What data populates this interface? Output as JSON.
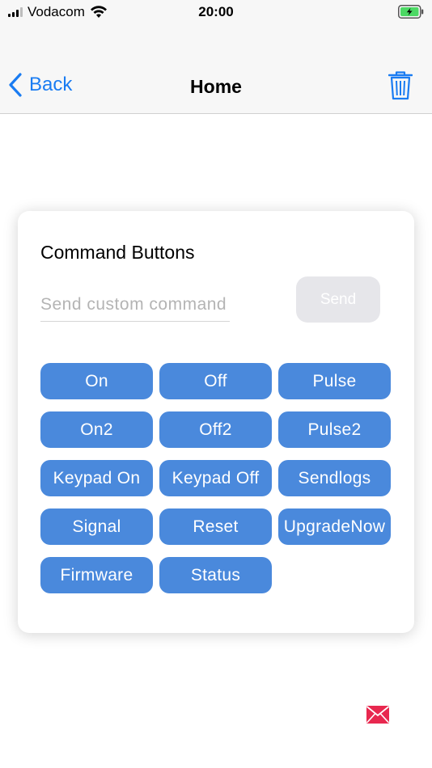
{
  "status_bar": {
    "carrier": "Vodacom",
    "time": "20:00",
    "icons": [
      "signal-icon",
      "wifi-icon",
      "battery-charging-icon"
    ],
    "battery_color": "#4cd964"
  },
  "nav_bar": {
    "back_label": "Back",
    "title": "Home",
    "right_icon": "trash-icon",
    "accent_color": "#1a7cf2"
  },
  "command_card": {
    "title": "Command Buttons",
    "input_placeholder": "Send custom command",
    "input_value": "",
    "send_label": "Send",
    "button_color": "#4a89dc",
    "buttons": [
      {
        "label": "On"
      },
      {
        "label": "Off"
      },
      {
        "label": "Pulse"
      },
      {
        "label": "On2"
      },
      {
        "label": "Off2"
      },
      {
        "label": "Pulse2"
      },
      {
        "label": "Keypad On"
      },
      {
        "label": "Keypad Off"
      },
      {
        "label": "Sendlogs"
      },
      {
        "label": "Signal"
      },
      {
        "label": "Reset"
      },
      {
        "label": "UpgradeNow"
      },
      {
        "label": "Firmware"
      },
      {
        "label": "Status"
      }
    ]
  },
  "footer": {
    "icon": "mail-icon",
    "icon_color": "#e8284f"
  }
}
